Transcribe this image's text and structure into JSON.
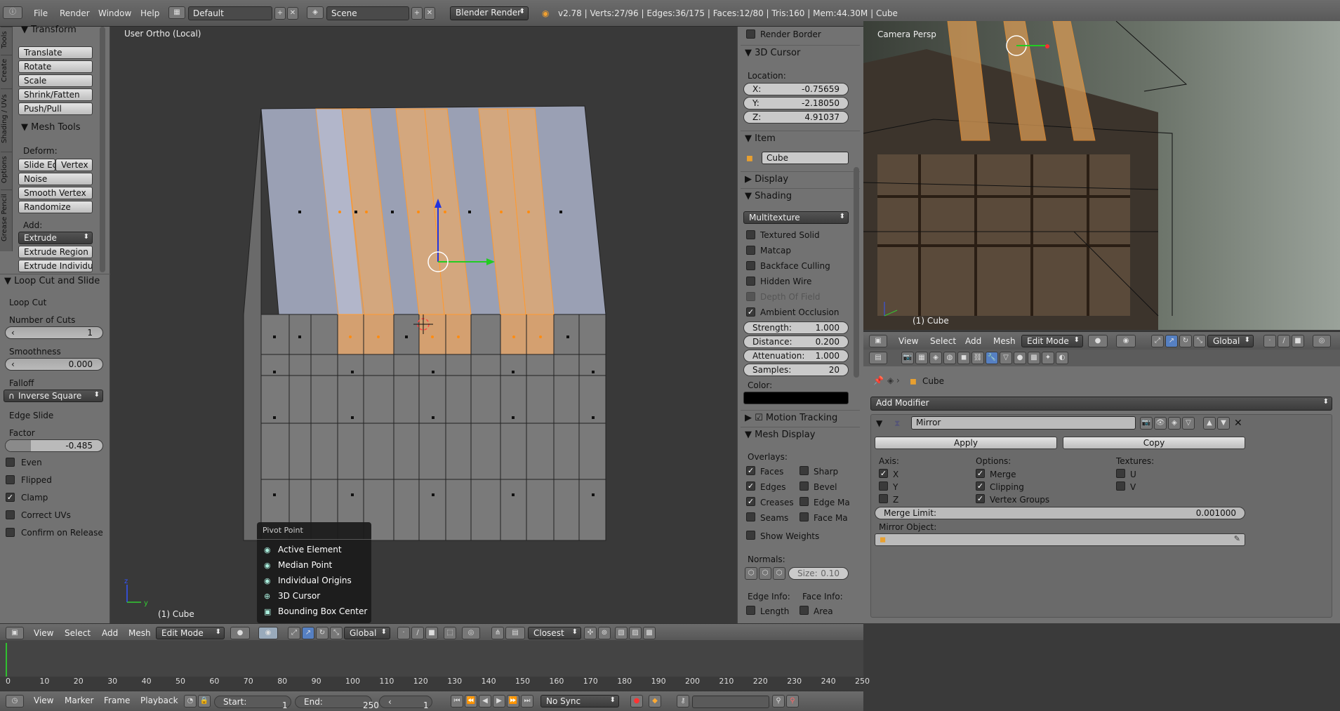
{
  "topbar": {
    "menus": [
      "File",
      "Render",
      "Window",
      "Help"
    ],
    "layout": "Default",
    "scene": "Scene",
    "engine": "Blender Render",
    "stats": "v2.78 | Verts:27/96 | Edges:36/175 | Faces:12/80 | Tris:160 | Mem:44.30M | Cube"
  },
  "tools": {
    "tabs": [
      "Tools",
      "Create",
      "Shading / UVs",
      "Options",
      "Grease Pencil"
    ],
    "transform_title": "Transform",
    "transform": [
      "Translate",
      "Rotate",
      "Scale",
      "Shrink/Fatten",
      "Push/Pull"
    ],
    "mesh_tools_title": "Mesh Tools",
    "deform_label": "Deform:",
    "slide_edge": "Slide Ed",
    "vertex": "Vertex",
    "noise": "Noise",
    "smooth_vertex": "Smooth Vertex",
    "randomize": "Randomize",
    "add_label": "Add:",
    "extrude": "Extrude",
    "extrude_region": "Extrude Region",
    "extrude_individual": "Extrude Individual"
  },
  "operator": {
    "title": "Loop Cut and Slide",
    "loop_cut": "Loop Cut",
    "number_of_cuts_label": "Number of Cuts",
    "number_of_cuts": "1",
    "smoothness_label": "Smoothness",
    "smoothness": "0.000",
    "falloff_label": "Falloff",
    "falloff": "Inverse Square",
    "edge_slide": "Edge Slide",
    "factor_label": "Factor",
    "factor": "-0.485",
    "factor_level": 0.26,
    "even": "Even",
    "flipped": "Flipped",
    "clamp": "Clamp",
    "correct_uvs": "Correct UVs",
    "confirm": "Confirm on Release"
  },
  "viewport": {
    "label": "User Ortho (Local)",
    "object": "(1) Cube"
  },
  "pivot_menu": {
    "title": "Pivot Point",
    "items": [
      "Active Element",
      "Median Point",
      "Individual Origins",
      "3D Cursor",
      "Bounding Box Center"
    ]
  },
  "vp_header": {
    "view": "View",
    "select": "Select",
    "add": "Add",
    "mesh": "Mesh",
    "mode": "Edit Mode",
    "orientation": "Global",
    "snap": "Closest"
  },
  "npanel": {
    "render_border": "Render Border",
    "cursor_title": "3D Cursor",
    "location_label": "Location:",
    "x_label": "X:",
    "x": "-0.75659",
    "y_label": "Y:",
    "y": "-2.18050",
    "z_label": "Z:",
    "z": "4.91037",
    "item_title": "Item",
    "item_name": "Cube",
    "display": "Display",
    "shading": "Shading",
    "shading_mode": "Multitexture",
    "textured_solid": "Textured Solid",
    "matcap": "Matcap",
    "backface": "Backface Culling",
    "hidden_wire": "Hidden Wire",
    "dof": "Depth Of Field",
    "ao": "Ambient Occlusion",
    "strength_label": "Strength:",
    "strength": "1.000",
    "distance_label": "Distance:",
    "distance": "0.200",
    "attenuation_label": "Attenuation:",
    "attenuation": "1.000",
    "samples_label": "Samples:",
    "samples": "20",
    "color_label": "Color:",
    "motion_tracking": "Motion Tracking",
    "mesh_display": "Mesh Display",
    "overlays": "Overlays:",
    "faces": "Faces",
    "sharp": "Sharp",
    "edges": "Edges",
    "bevel": "Bevel",
    "creases": "Creases",
    "edge_marks": "Edge Ma",
    "seams": "Seams",
    "face_marks": "Face Ma",
    "show_weights": "Show Weights",
    "normals": "Normals:",
    "size_label": "Size:",
    "size": "0.10",
    "edge_info": "Edge Info:",
    "face_info": "Face Info:",
    "length": "Length",
    "area": "Area"
  },
  "camera": {
    "label": "Camera Persp",
    "object": "(1) Cube",
    "header": {
      "view": "View",
      "select": "Select",
      "add": "Add",
      "mesh": "Mesh",
      "mode": "Edit Mode",
      "orientation": "Global"
    }
  },
  "properties": {
    "object": "Cube",
    "add_modifier": "Add Modifier",
    "modifier_name": "Mirror",
    "apply": "Apply",
    "copy": "Copy",
    "axis_label": "Axis:",
    "x": "X",
    "y": "Y",
    "z": "Z",
    "options_label": "Options:",
    "merge": "Merge",
    "clipping": "Clipping",
    "vertex_groups": "Vertex Groups",
    "textures_label": "Textures:",
    "u": "U",
    "v": "V",
    "merge_limit_label": "Merge Limit:",
    "merge_limit": "0.001000",
    "mirror_object_label": "Mirror Object:"
  },
  "timeline": {
    "ticks": [
      "0",
      "10",
      "20",
      "30",
      "40",
      "50",
      "60",
      "70",
      "80",
      "90",
      "100",
      "110",
      "120",
      "130",
      "140",
      "150",
      "160",
      "170",
      "180",
      "190",
      "200",
      "210",
      "220",
      "230",
      "240",
      "250"
    ],
    "view": "View",
    "marker": "Marker",
    "frame": "Frame",
    "playback": "Playback",
    "start_label": "Start:",
    "start": "1",
    "end_label": "End:",
    "end": "250",
    "current": "1",
    "sync": "No Sync"
  }
}
